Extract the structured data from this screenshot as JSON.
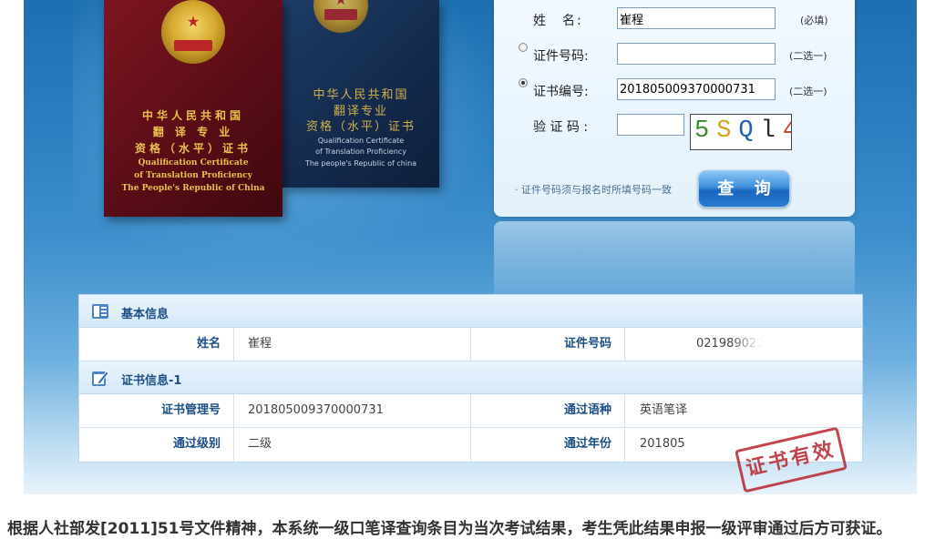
{
  "certificates": {
    "red": {
      "cn_lines": [
        "中华人民共和国",
        "翻 译 专 业",
        "资格（水平）证书"
      ],
      "en_lines": [
        "Qualification Certificate",
        "of Translation Proficiency",
        "The People's Republic of China"
      ]
    },
    "blue": {
      "cn_lines": [
        "中华人民共和国",
        "翻译专业",
        "资格（水平）证书"
      ],
      "en_lines": [
        "Qualification Certificate",
        "of Translation Proficiency",
        "The people's Republic of china"
      ]
    }
  },
  "form": {
    "name_label": "姓　名:",
    "name_value": "崔程",
    "required_hint": "(必填)",
    "id_label": "证件号码:",
    "id_value": "",
    "cert_no_label": "证书编号:",
    "cert_no_value": "201805009370000731",
    "choose_hint": "(二选一)",
    "captcha_label": "验 证 码 :",
    "captcha_value": "",
    "captcha_chars": [
      "5",
      "S",
      "Q",
      "l",
      "4"
    ],
    "selected_radio": "cert_no",
    "note": "· 证件号码须与报名时所填号码一致",
    "query_button": "查 询"
  },
  "results": {
    "basic_title": "基本信息",
    "name_label": "姓名",
    "name_value": "崔程",
    "id_label": "证件号码",
    "id_value": "021989022",
    "cert_title": "证书信息-1",
    "cert_mgmt_label": "证书管理号",
    "cert_mgmt_value": "201805009370000731",
    "language_label": "通过语种",
    "language_value": "英语笔译",
    "level_label": "通过级别",
    "level_value": "二级",
    "year_label": "通过年份",
    "year_value": "201805"
  },
  "stamp_text": "证书有效",
  "bottom_note": "根据人社部发[2011]51号文件精神，本系统一级口笔译查询条目为当次考试结果，考生凭此结果申报一级评审通过后方可获证。",
  "colors": {
    "backdrop": "#2b7fc0",
    "label_blue": "#1d4e86",
    "stamp_red": "#b8252e",
    "button_blue": "#1866bd"
  }
}
